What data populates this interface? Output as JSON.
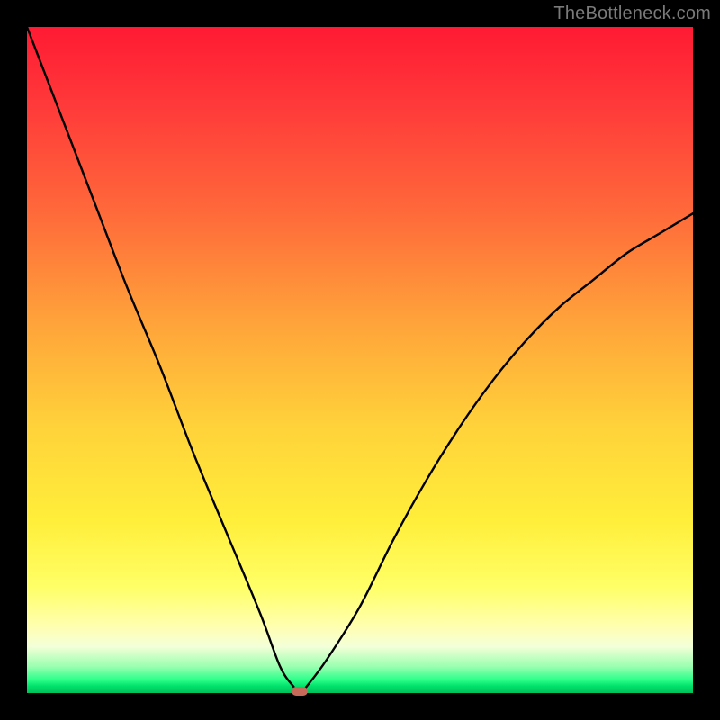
{
  "watermark": "TheBottleneck.com",
  "chart_data": {
    "type": "line",
    "title": "",
    "xlabel": "",
    "ylabel": "",
    "xlim": [
      0,
      100
    ],
    "ylim": [
      0,
      100
    ],
    "grid": false,
    "legend": false,
    "background_gradient": {
      "direction": "vertical",
      "stops": [
        {
          "pos": 0,
          "color": "#ff1a33"
        },
        {
          "pos": 50,
          "color": "#ffb83a"
        },
        {
          "pos": 83,
          "color": "#ffff66"
        },
        {
          "pos": 92,
          "color": "#ffffcc"
        },
        {
          "pos": 100,
          "color": "#00c05a"
        }
      ]
    },
    "series": [
      {
        "name": "bottleneck-curve",
        "x": [
          0,
          5,
          10,
          15,
          20,
          25,
          30,
          35,
          38,
          40,
          41,
          42,
          45,
          50,
          55,
          60,
          65,
          70,
          75,
          80,
          85,
          90,
          95,
          100
        ],
        "y": [
          100,
          87,
          74,
          61,
          49,
          36,
          24,
          12,
          4,
          1,
          0,
          1,
          5,
          13,
          23,
          32,
          40,
          47,
          53,
          58,
          62,
          66,
          69,
          72
        ]
      }
    ],
    "annotations": [
      {
        "name": "min-marker",
        "x": 41,
        "y": 0,
        "shape": "rounded-rect",
        "color": "#c86a5a"
      }
    ]
  }
}
